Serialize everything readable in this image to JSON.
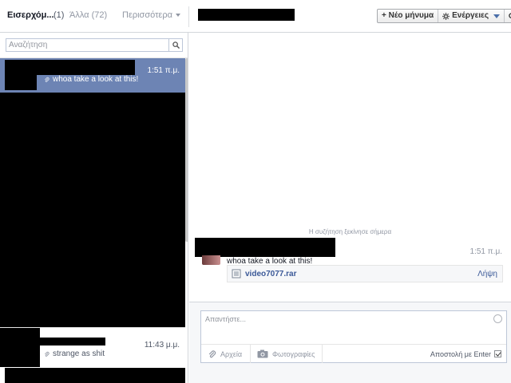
{
  "header": {
    "inbox_label": "Εισερχόμ...",
    "inbox_count": "(1)",
    "other_label": "Άλλα (72)",
    "more_label": "Περισσότερα",
    "new_message_label": "+ Νέο μήνυμα",
    "actions_label": "Ενέργειες"
  },
  "search": {
    "placeholder": "Αναζήτηση"
  },
  "threads": [
    {
      "time": "1:51 π.μ.",
      "snippet": "whoa take a look at this!",
      "selected": true
    },
    {
      "time": "11:43 μ.μ.",
      "snippet": "strange as shit",
      "selected": false
    }
  ],
  "conversation": {
    "started_text": "Η συζήτηση ξεκίνησε σήμερα",
    "message_time": "1:51 π.μ.",
    "message_text": "whoa take a look at this!",
    "attachment_name": "video7077.rar",
    "attachment_action": "Λήψη"
  },
  "composer": {
    "placeholder": "Απαντήστε...",
    "files_label": "Αρχεία",
    "photos_label": "Φωτογραφίες",
    "enter_send_label": "Αποστολή με Enter"
  },
  "colors": {
    "selected_thread": "#6d84b4",
    "link": "#3b5998"
  }
}
